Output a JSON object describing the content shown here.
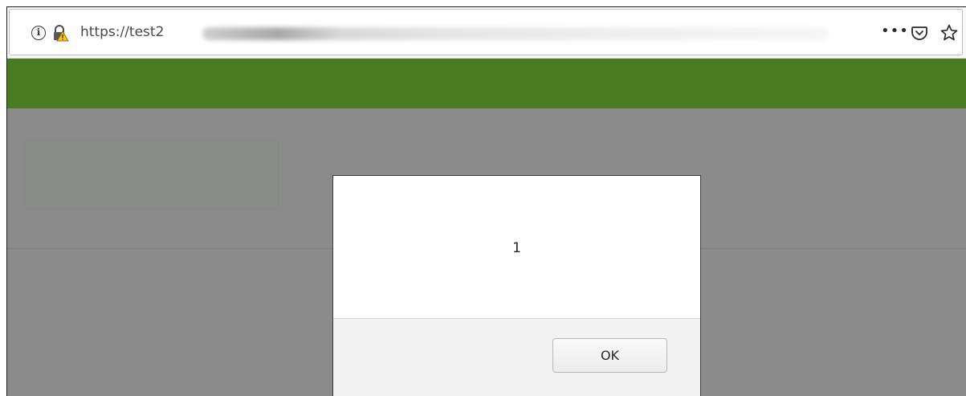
{
  "browser": {
    "url_visible": "https://test2",
    "icons": {
      "info": "info-icon",
      "lock": "lock-warning-icon",
      "more": "more-icon",
      "pocket": "pocket-icon",
      "bookmark": "star-icon"
    },
    "info_glyph": "i",
    "more_glyph": "•••"
  },
  "page": {
    "colors": {
      "overlay": "#8b8b8b",
      "header_green": "#4a7b23"
    }
  },
  "dialog": {
    "message": "1",
    "ok_label": "OK"
  }
}
